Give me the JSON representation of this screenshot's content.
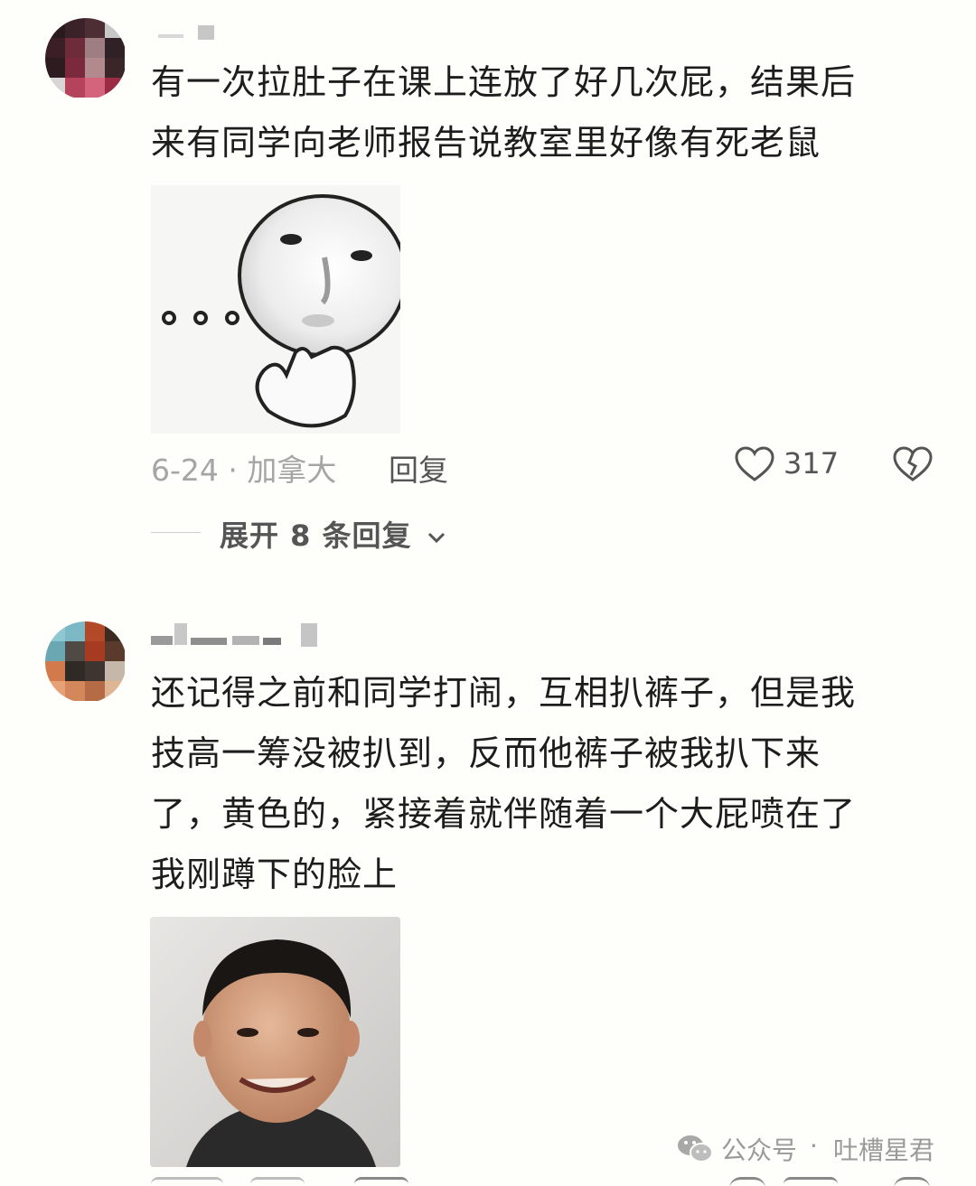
{
  "comments": [
    {
      "text_line1": "有一次拉肚子在课上连放了好几次屁，结果后",
      "text_line2": "来有同学向老师报告说教室里好像有死老鼠",
      "date_location": "6-24 · 加拿大",
      "reply_label": "回复",
      "likes": "317",
      "expand_label": "展开 8 条回复"
    },
    {
      "text_line1": "还记得之前和同学打闹，互相扒裤子，但是我",
      "text_line2": "技高一筹没被扒到，反而他裤子被我扒下来",
      "text_line3": "了，黄色的，紧接着就伴随着一个大屁喷在了",
      "text_line4": "我刚蹲下的脸上",
      "date_location": "",
      "reply_label": "回复",
      "likes": ""
    }
  ],
  "watermark": {
    "prefix": "公众号",
    "separator": "·",
    "name": "吐槽星君"
  },
  "colors": {
    "background": "#fefefb",
    "text": "#1d1d1d",
    "meta": "#a5a5a5",
    "action": "#555555"
  },
  "icons": [
    "heart-icon",
    "dislike-broken-heart-icon",
    "chevron-down-icon",
    "wechat-icon"
  ]
}
